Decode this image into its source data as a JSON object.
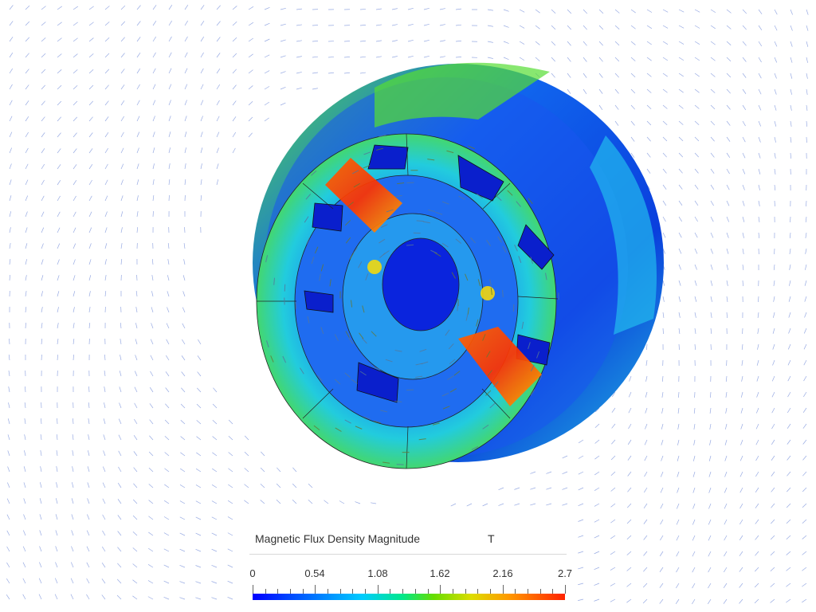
{
  "legend": {
    "title": "Magnetic Flux Density Magnitude",
    "unit": "T",
    "ticks": [
      "0",
      "0.54",
      "1.08",
      "1.62",
      "2.16",
      "2.7"
    ],
    "range": [
      0,
      2.7
    ],
    "colormap": [
      "#0000ff",
      "#00ccff",
      "#66dd00",
      "#dddd00",
      "#ff9900",
      "#ff2200"
    ]
  },
  "scene": {
    "background": "#ffffff",
    "arrow_color": "#4466cc",
    "mesh_color": "#222222"
  }
}
